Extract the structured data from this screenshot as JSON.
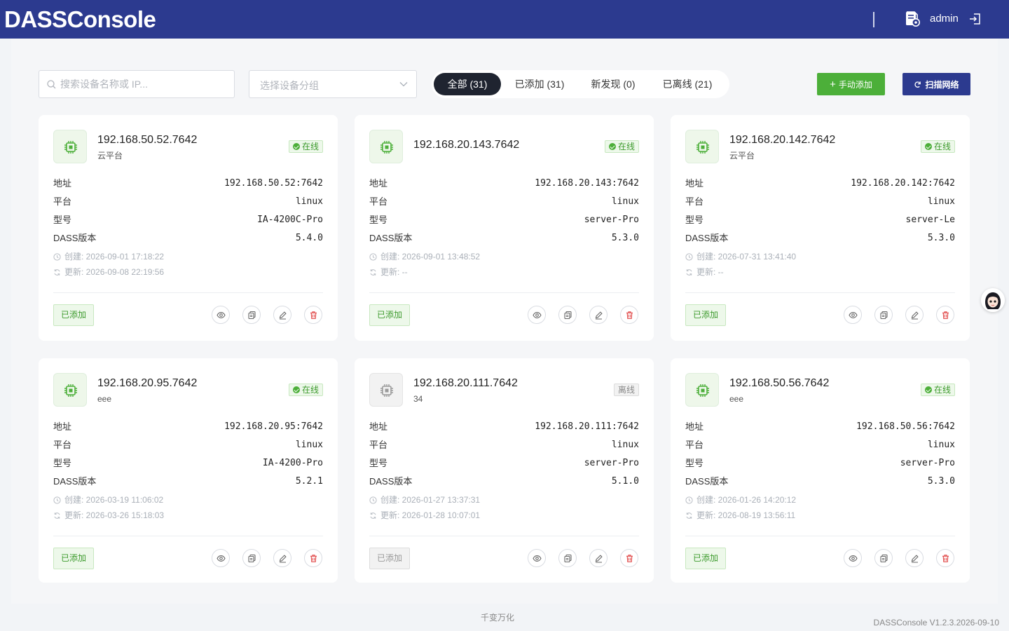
{
  "header": {
    "brand": "DASSConsole",
    "username": "admin",
    "doc_icon": "document-gear-icon",
    "logout_icon": "logout-icon"
  },
  "toolbar": {
    "search_placeholder": "搜索设备名称或 IP...",
    "group_placeholder": "选择设备分组",
    "tabs": [
      {
        "label": "全部 (31)",
        "active": true
      },
      {
        "label": "已添加 (31)",
        "active": false
      },
      {
        "label": "新发现 (0)",
        "active": false
      },
      {
        "label": "已离线 (21)",
        "active": false
      }
    ],
    "add_label": "手动添加",
    "scan_label": "扫描网络"
  },
  "labels": {
    "address": "地址",
    "platform": "平台",
    "model": "型号",
    "version": "DASS版本"
  },
  "devices": [
    {
      "title": "192.168.50.52.7642",
      "subtitle": "云平台",
      "status": "在线",
      "online": true,
      "address": "192.168.50.52:7642",
      "platform": "linux",
      "model": "IA-4200C-Pro",
      "version": "5.4.0",
      "created": "创建: 2026-09-01 17:18:22",
      "updated": "更新: 2026-09-08 22:19:56",
      "tag": "已添加"
    },
    {
      "title": "192.168.20.143.7642",
      "subtitle": "",
      "status": "在线",
      "online": true,
      "address": "192.168.20.143:7642",
      "platform": "linux",
      "model": "server-Pro",
      "version": "5.3.0",
      "created": "创建: 2026-09-01 13:48:52",
      "updated": "更新: --",
      "tag": "已添加"
    },
    {
      "title": "192.168.20.142.7642",
      "subtitle": "云平台",
      "status": "在线",
      "online": true,
      "address": "192.168.20.142:7642",
      "platform": "linux",
      "model": "server-Le",
      "version": "5.3.0",
      "created": "创建: 2026-07-31 13:41:40",
      "updated": "更新: --",
      "tag": "已添加"
    },
    {
      "title": "192.168.20.95.7642",
      "subtitle": "eee",
      "status": "在线",
      "online": true,
      "address": "192.168.20.95:7642",
      "platform": "linux",
      "model": "IA-4200-Pro",
      "version": "5.2.1",
      "created": "创建: 2026-03-19 11:06:02",
      "updated": "更新: 2026-03-26 15:18:03",
      "tag": "已添加"
    },
    {
      "title": "192.168.20.111.7642",
      "subtitle": "34",
      "status": "离线",
      "online": false,
      "address": "192.168.20.111:7642",
      "platform": "linux",
      "model": "server-Pro",
      "version": "5.1.0",
      "created": "创建: 2026-01-27 13:37:31",
      "updated": "更新: 2026-01-28 10:07:01",
      "tag": "已添加"
    },
    {
      "title": "192.168.50.56.7642",
      "subtitle": "eee",
      "status": "在线",
      "online": true,
      "address": "192.168.50.56:7642",
      "platform": "linux",
      "model": "server-Pro",
      "version": "5.3.0",
      "created": "创建: 2026-01-26 14:20:12",
      "updated": "更新: 2026-08-19 13:56:11",
      "tag": "已添加"
    }
  ],
  "footer": {
    "center": "千变万化",
    "version": "DASSConsole V1.2.3.2026-09-10"
  },
  "colors": {
    "header_bg": "#2c3a8f",
    "online": "#4caf39",
    "delete": "#e04545"
  }
}
